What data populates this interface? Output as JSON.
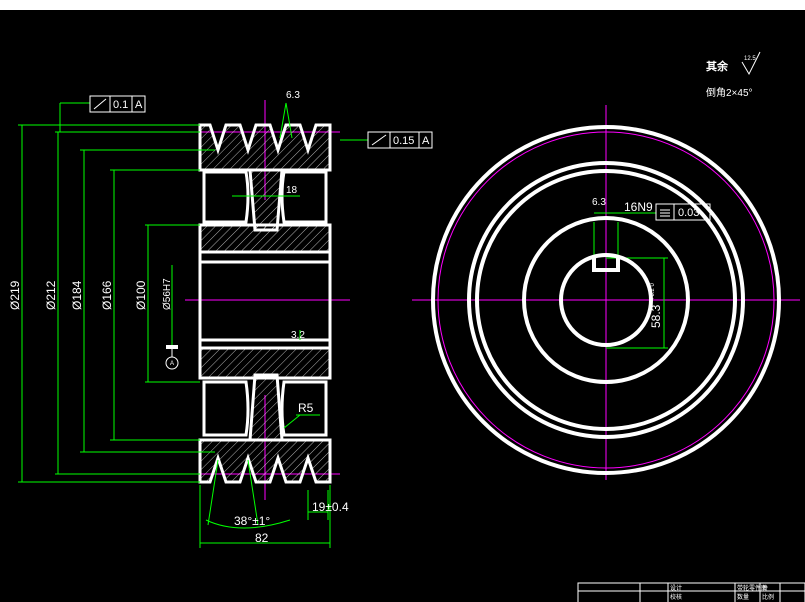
{
  "colors": {
    "background": "#000000",
    "outline": "#ffffff",
    "dimension": "#00ff00",
    "centerline": "#ff00ff"
  },
  "notes": {
    "qiyu": "其余",
    "qiyu_roughness": "12.5",
    "chamfer": "倒角2×45°"
  },
  "tolerances": {
    "left_frame_value": "0.1",
    "left_frame_datum": "A",
    "right_frame_value": "0.15",
    "right_frame_datum": "A",
    "keyway_frame_value": "0.03"
  },
  "dimensions": {
    "d219": "Ø219",
    "d212": "Ø212",
    "d184": "Ø184",
    "d166": "Ø166",
    "d100": "Ø100",
    "d56": "Ø56H7",
    "web": "18",
    "fillet": "R5",
    "angle": "38°±1°",
    "pitch": "19±0.4",
    "width": "82",
    "keyway_width": "16N9",
    "keyway_depth": "58.3",
    "keyway_tol": "+0.2\n0",
    "datum": "A"
  },
  "roughness": {
    "groove": "6.3",
    "bore": "3.2",
    "keyway": "6.3"
  },
  "title_block": {
    "designer_label": "设计",
    "checker_label": "校核",
    "name_label": "带轮零件图",
    "scale_label": "比例",
    "qty_label": "数量",
    "sheet_label": "件"
  }
}
